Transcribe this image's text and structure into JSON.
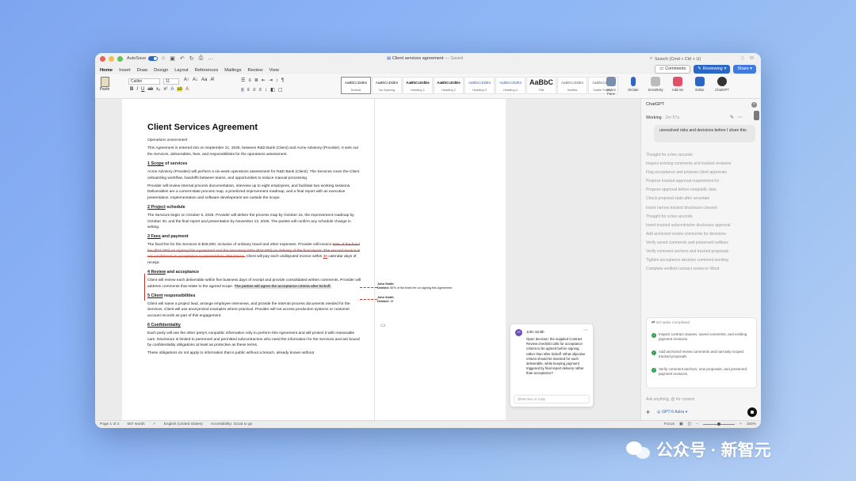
{
  "window": {
    "autosave_label": "AutoSave",
    "doc_title": "Client services agreement",
    "doc_status": "— Saved",
    "search_placeholder": "Search (Cmd + Ctrl + U)"
  },
  "menu": {
    "tabs": [
      "Home",
      "Insert",
      "Draw",
      "Design",
      "Layout",
      "References",
      "Mailings",
      "Review",
      "View"
    ],
    "comments_label": "Comments",
    "reviewing_label": "Reviewing",
    "share_label": "Share"
  },
  "ribbon": {
    "paste_label": "Paste",
    "font_name": "Calibri",
    "font_size": "11",
    "styles": [
      {
        "preview": "AaBbCcDdEe",
        "name": "Normal"
      },
      {
        "preview": "AaBbCcDdEe",
        "name": "No Spacing"
      },
      {
        "preview": "AaBbCcDdEe",
        "name": "Heading 1"
      },
      {
        "preview": "AaBbCcDdEe",
        "name": "Heading 2"
      },
      {
        "preview": "AaBbCcDdEe",
        "name": "Heading 3"
      },
      {
        "preview": "AaBbCcDdEe",
        "name": "Heading 4"
      },
      {
        "preview": "AaBbC",
        "name": "Title"
      },
      {
        "preview": "AaBbCcDdEe",
        "name": "Subtitle"
      },
      {
        "preview": "AaBbCcDdEe",
        "name": "Subtle Emph..."
      }
    ],
    "tools": [
      {
        "label": "Styles Pane",
        "color": "#7a8fb0"
      },
      {
        "label": "Dictate",
        "color": "#2b67c4"
      },
      {
        "label": "Sensitivity",
        "color": "#bbbbbb"
      },
      {
        "label": "Add-ins",
        "color": "#e0506a"
      },
      {
        "label": "Editor",
        "color": "#2b67c4"
      },
      {
        "label": "ChatGPT",
        "color": "#333333"
      }
    ]
  },
  "document": {
    "title": "Client Services Agreement",
    "subtitle": "Operations assessment",
    "intro": "This Agreement is entered into on September 21, 2026, between R&D Bank (Client) and Acme Advisory (Provider). It sets out the Services, deliverables, fees, and responsibilities for the operations assessment.",
    "s1_num": "1",
    "s1_word": "Scope",
    "s1_rest": " of services",
    "s1_p1": "Acme Advisory (Provider) will perform a six-week operations assessment for R&D Bank (Client). The Services cover the Client onboarding workflow, handoffs between teams, and opportunities to reduce manual processing.",
    "s1_p2": "Provider will review internal process documentation, interview up to eight employees, and facilitate two working sessions. Deliverables are a current-state process map, a prioritized improvement roadmap, and a final report with an executive presentation. Implementation and software development are outside the scope.",
    "s2_num": "2",
    "s2_word": "Project",
    "s2_rest": " schedule",
    "s2_p1": "The Services begin on October 5, 2026. Provider will deliver the process map by October 16, the improvement roadmap by October 30, and the final report and presentation by November 13, 2026. The parties will confirm any schedule change in writing.",
    "s3_num": "3",
    "s3_word": "Fees",
    "s3_rest": " and payment",
    "s3_a": "The fixed fee for the Services is $48,000, inclusive of ordinary travel and other expenses. Provider will invoice ",
    "s3_del": "50% of the fixed fee ($24,000) on signing this Agreement and the remaining 50% ($24,000) on delivery of the final report. The second invoice is not conditional on acceptance or presentation attendance.",
    "s3_b": " Client will pay each undisputed invoice within ",
    "s3_days": "30",
    "s3_c": " calendar days of receipt.",
    "s4_num": "4",
    "s4_word": "Review",
    "s4_rest": " and acceptance",
    "s4_a": "Client will review each deliverable within five business days of receipt and provide consolidated written comments. Provider will address comments that relate to the agreed scope. ",
    "s4_hl": "The parties will agree the acceptance criteria after kickoff.",
    "s5_num": "5",
    "s5_word": "Client",
    "s5_rest": " responsibilities",
    "s5_p1": "Client will name a project lead, arrange employee interviews, and provide the internal process documents needed for the Services. Client will use anonymized examples where practical. Provider will not access production systems or customer account records as part of this engagement.",
    "s6_num": "6",
    "s6_word": "Confidentiality",
    "s6_p1": "Each party will use the other party's nonpublic information only to perform this Agreement and will protect it with reasonable care. Disclosure is limited to personnel and permitted subcontractors who need the information for the Services and are bound by confidentiality obligations at least as protective as these terms.",
    "s6_p2": "These obligations do not apply to information that is public without a breach, already known without"
  },
  "revisions": [
    {
      "author": "John Smith",
      "label": "Deleted:",
      "text": "50% of the fixed fee on signing this Agreement"
    },
    {
      "author": "John Smith",
      "label": "Deleted:",
      "text": "15"
    }
  ],
  "comment": {
    "initials": "JS",
    "author": "John Smith",
    "body": "Open decision: the supplied Contract Review checklist calls for acceptance criteria to be agreed before signing, rather than after kickoff. What objective criteria should be inserted for each deliverable, while keeping payment triggered by final report delivery rather than acceptance?",
    "reply_placeholder": "@Mention or reply"
  },
  "chatgpt": {
    "panel_title": "ChatGPT",
    "working_label": "Working",
    "working_time": "· 2m 57s",
    "bubble": "unresolved risks and decisions before I share this.",
    "steps": [
      "Thought for a few seconds",
      "Inspect existing comments and tracked revisions",
      "Flag acceptance and propose client approvals",
      "Propose tracked approval requirement for",
      "Propose approval before nonpublic data",
      "Check proposal state after uncertain",
      "Insert narrow tracked disclosure consent",
      "Thought for a few seconds",
      "Insert tracked subcontractor disclosure approval",
      "Add anchored review comments for decisions",
      "Verify saved comments and preserved redlines",
      "Verify comment anchors and tracked proposals",
      "Tighten acceptance decision comment wording",
      "Complete verified contract review in Word"
    ],
    "tasks_label": "3/3 tasks completed",
    "tasks": [
      "Inspect contract clauses, saved comments, and existing payment revisions",
      "Add anchored review comments and narrowly scoped tracked proposals",
      "Verify comment anchors, new proposals, and preserved payment revisions"
    ],
    "input_placeholder": "Ask anything, @ for context",
    "model_label": "GPT-5 Astra"
  },
  "status": {
    "page": "Page 1 of 2",
    "words": "667 words",
    "language": "English (United States)",
    "accessibility": "Accessibility: Good to go",
    "focus": "Focus",
    "zoom": "100%"
  },
  "watermark": {
    "text": "公众号 · 新智元"
  }
}
